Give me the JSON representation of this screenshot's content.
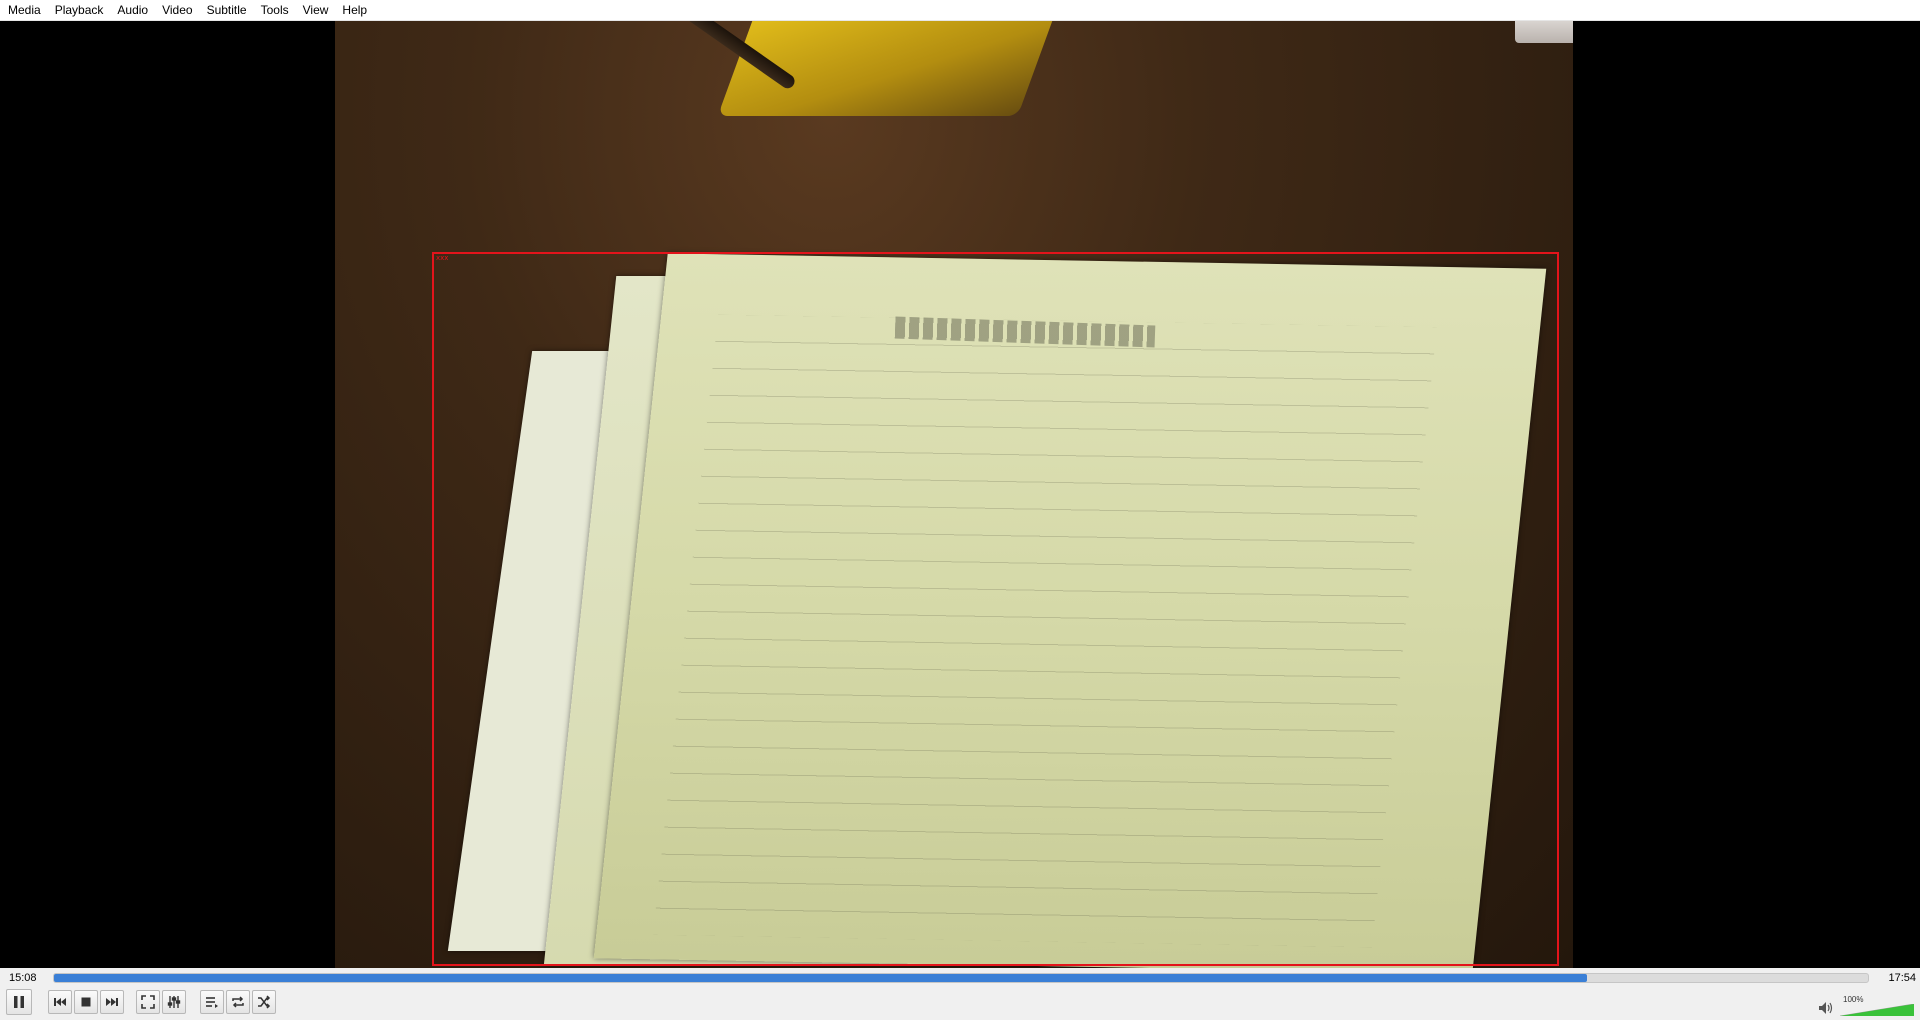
{
  "menu": {
    "items": [
      "Media",
      "Playback",
      "Audio",
      "Video",
      "Subtitle",
      "Tools",
      "View",
      "Help"
    ]
  },
  "video": {
    "selection_label": "xxx"
  },
  "player": {
    "time_elapsed": "15:08",
    "time_total": "17:54",
    "progress_fraction": 0.845,
    "volume_label": "100%",
    "volume_fraction": 1.0,
    "accent_color": "#3a7fd6",
    "volume_color": "#3ac23a",
    "selection_color": "#e3141b"
  },
  "buttons": [
    {
      "name": "pause-button",
      "icon": "pause-icon"
    },
    {
      "name": "previous-button",
      "icon": "skip-back-icon"
    },
    {
      "name": "stop-button",
      "icon": "stop-icon"
    },
    {
      "name": "next-button",
      "icon": "skip-forward-icon"
    },
    {
      "name": "fullscreen-button",
      "icon": "fullscreen-icon"
    },
    {
      "name": "extended-settings-button",
      "icon": "equalizer-icon"
    },
    {
      "name": "playlist-button",
      "icon": "playlist-icon"
    },
    {
      "name": "loop-button",
      "icon": "loop-icon"
    },
    {
      "name": "shuffle-button",
      "icon": "shuffle-icon"
    }
  ]
}
